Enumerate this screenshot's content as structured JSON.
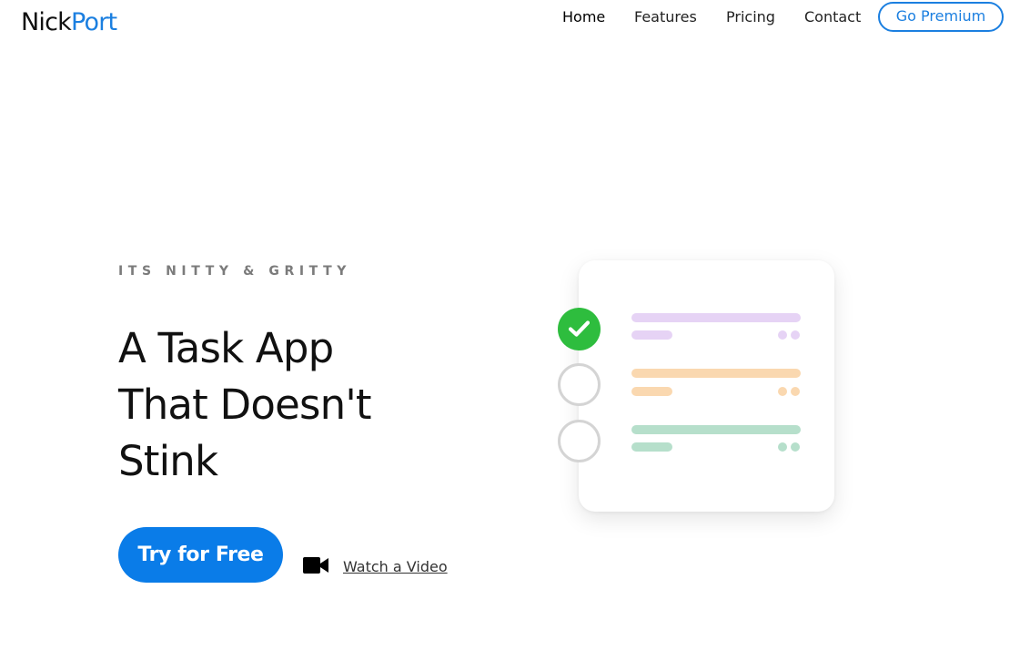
{
  "brand": {
    "part1": "Nick",
    "part2": "Port",
    "accent": "#1b7fe0"
  },
  "nav": {
    "items": [
      "Home",
      "Features",
      "Pricing",
      "Contact"
    ],
    "active": "Home",
    "premium_label": "Go Premium"
  },
  "hero": {
    "eyebrow": "ITS NITTY & GRITTY",
    "headline_lines": [
      "A Task App",
      "That Doesn't",
      "Stink"
    ],
    "cta_label": "Try for Free",
    "video_label": "Watch a Video",
    "cta_color": "#0a7ce8"
  },
  "illustration": {
    "tasks": [
      {
        "done": true,
        "color": "#e6d3f5",
        "icon": "check-icon"
      },
      {
        "done": false,
        "color": "#fad8b0",
        "icon": "empty-circle-icon"
      },
      {
        "done": false,
        "color": "#b6dfcb",
        "icon": "empty-circle-icon"
      }
    ],
    "check_color": "#2ebd3e"
  }
}
